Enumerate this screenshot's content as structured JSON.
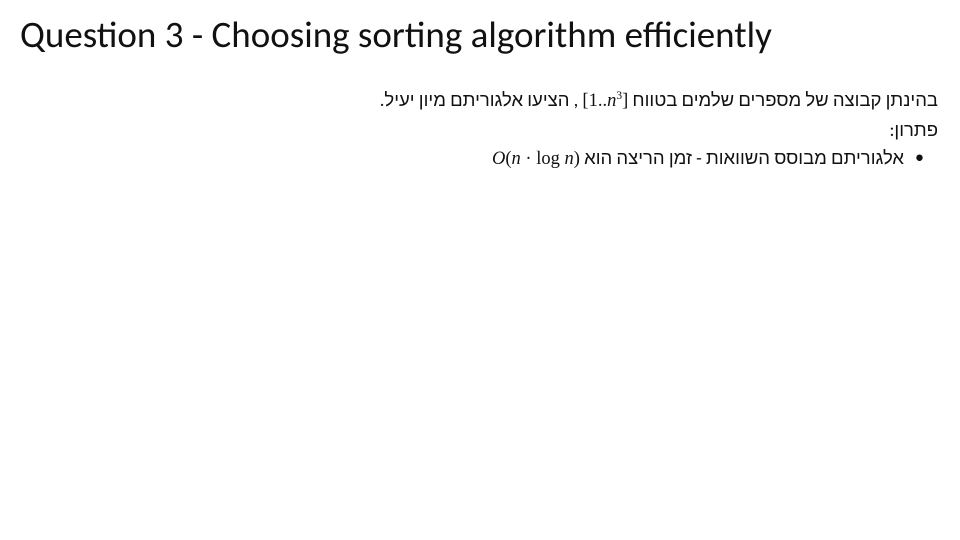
{
  "title": "Question 3 - Choosing sorting algorithm efficiently",
  "body": {
    "l1_pre": "בהינתן קבוצה של מספרים שלמים בטווח ",
    "l1_range_open": "[1..",
    "l1_n": "n",
    "l1_exp": "3",
    "l1_range_close": "]",
    "l1_post": ", הציעו אלגוריתם מיון יעיל.",
    "l2": "פתרון:",
    "l3_pre": "אלגוריתם מבוסס השוואות - זמן הריצה הוא ",
    "l3_O": "O",
    "l3_open": "(",
    "l3_n": "n",
    "l3_dot": " · ",
    "l3_log": "log ",
    "l3_n2": "n",
    "l3_close": ")"
  }
}
